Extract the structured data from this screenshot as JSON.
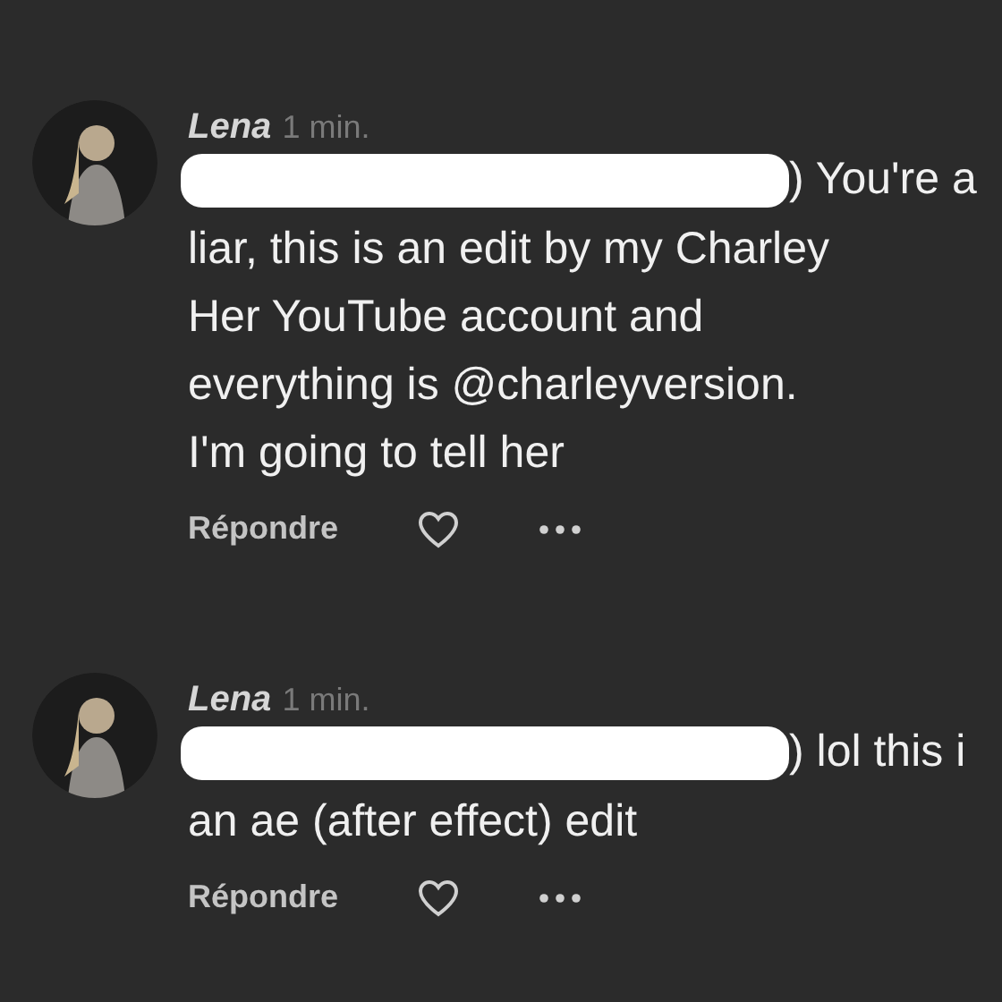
{
  "comments": [
    {
      "author": "Lena",
      "time": "1 min.",
      "lines": [
        ") You're a",
        "liar, this is an edit by my Charley",
        "Her YouTube account and",
        "everything is @charleyversion.",
        "I'm going to tell her"
      ],
      "reply_label": "Répondre",
      "liked": false
    },
    {
      "author": "Lena",
      "time": "1 min.",
      "lines": [
        ") lol this i",
        "an ae (after effect) edit"
      ],
      "reply_label": "Répondre",
      "liked": false
    }
  ]
}
